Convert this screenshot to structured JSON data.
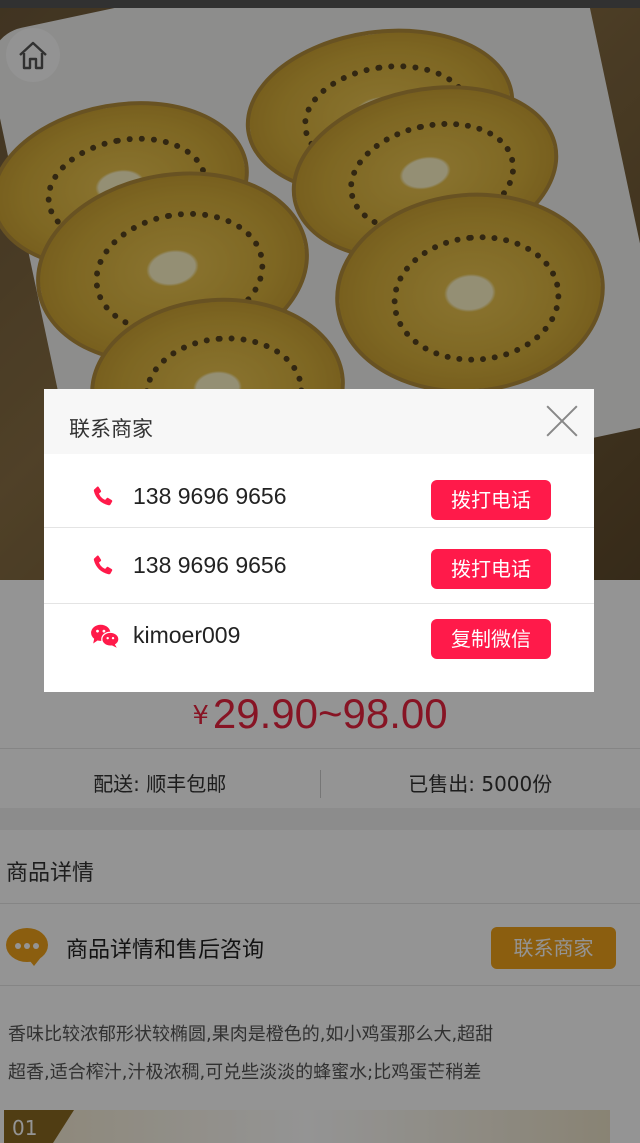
{
  "product": {
    "price_currency": "¥",
    "price_range": "29.90~98.00",
    "shipping_label": "配送:",
    "shipping_value": "顺丰包邮",
    "sold_label": "已售出:",
    "sold_value": "5000份"
  },
  "detail": {
    "section_title": "商品详情",
    "consult_text": "商品详情和售后咨询",
    "contact_button_label": "联系商家",
    "description_lines": [
      "香味比较浓郁形状较椭圆,果肉是橙色的,如小鸡蛋那么大,超甜",
      "超香,适合榨汁,汁极浓稠,可兑些淡淡的蜂蜜水;比鸡蛋芒稍差"
    ],
    "image_badge": "01"
  },
  "modal": {
    "title": "联系商家",
    "contacts": [
      {
        "icon": "phone-icon",
        "value": "138 9696 9656",
        "action_label": "拨打电话"
      },
      {
        "icon": "phone-icon",
        "value": "138 9696 9656",
        "action_label": "拨打电话"
      },
      {
        "icon": "wechat-icon",
        "value": "kimoer009",
        "action_label": "复制微信"
      }
    ]
  },
  "colors": {
    "accent_red": "#ff1a4a",
    "accent_orange": "#f0a21b",
    "price_red": "#e8233f"
  }
}
